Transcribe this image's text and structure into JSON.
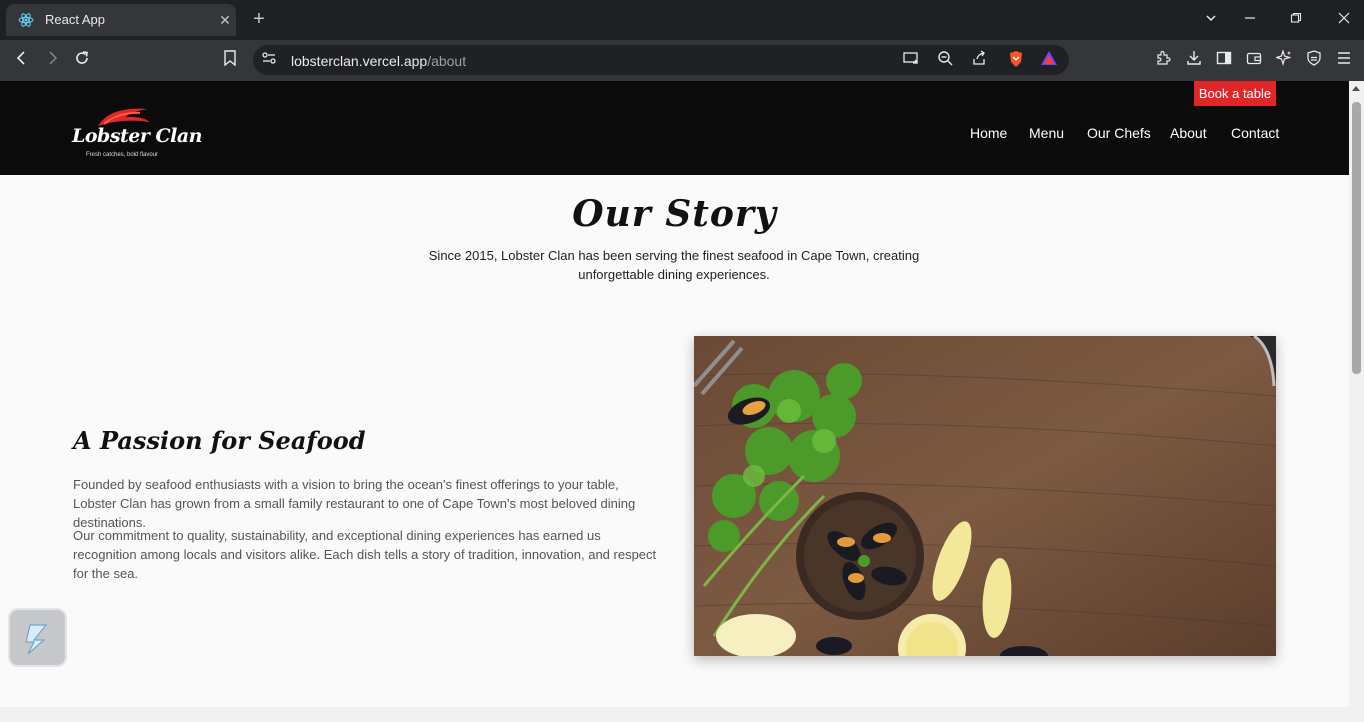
{
  "browser": {
    "tab_title": "React App",
    "tab_close": "✕",
    "new_tab": "+",
    "url_host": "lobsterclan.vercel.app",
    "url_path": "/about",
    "icons": [
      "react-favicon",
      "back-icon",
      "forward-icon",
      "reload-icon",
      "bookmark-icon",
      "site-settings-icon",
      "cast-icon",
      "zoom-icon",
      "share-icon",
      "brave-shield-icon",
      "rewards-icon",
      "extensions-icon",
      "download-icon",
      "sidebar-icon",
      "wallet-icon",
      "leo-icon",
      "vpn-icon",
      "menu-icon"
    ]
  },
  "header": {
    "logo_text": "Lobster Clan",
    "logo_tagline": "Fresh catches, bold flavour",
    "book_button": "Book a table",
    "nav": [
      "Home",
      "Menu",
      "Our Chefs",
      "About",
      "Contact"
    ]
  },
  "story": {
    "title": "Our Story",
    "subtitle": "Since 2015, Lobster Clan has been serving the finest seafood in Cape Town, creating unforgettable dining experiences."
  },
  "passion": {
    "title": "A Passion for Seafood",
    "paragraph1": "Founded by seafood enthusiasts with a vision to bring the ocean's finest offerings to your table, Lobster Clan has grown from a small family restaurant to one of Cape Town's most beloved dining destinations.",
    "paragraph2": "Our commitment to quality, sustainability, and exceptional dining experiences has earned us recognition among locals and visitors alike. Each dish tells a story of tradition, innovation, and respect for the sea."
  },
  "colors": {
    "accent_red": "#e1262a",
    "header_bg": "#0b0b0b",
    "page_bg": "#fafafa"
  }
}
